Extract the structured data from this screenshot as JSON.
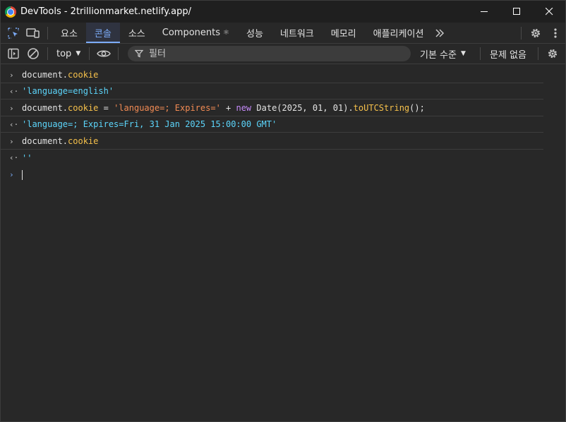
{
  "window": {
    "title": "DevTools - 2trillionmarket.netlify.app/",
    "controls": {
      "minimize": "─",
      "maximize": "☐",
      "close": "✕"
    }
  },
  "tabs": {
    "items": [
      {
        "label": "요소"
      },
      {
        "label": "콘솔"
      },
      {
        "label": "소스"
      },
      {
        "label": "Components",
        "badge": "⚛"
      },
      {
        "label": "성능"
      },
      {
        "label": "네트워크"
      },
      {
        "label": "메모리"
      },
      {
        "label": "애플리케이션"
      }
    ],
    "more": "»",
    "active_index": 1
  },
  "console_toolbar": {
    "context": "top",
    "filter_placeholder": "필터",
    "level": "기본 수준",
    "issues": "문제 없음"
  },
  "console": {
    "lines": [
      {
        "type": "input",
        "parts": [
          [
            "plain",
            "document."
          ],
          [
            "prop",
            "cookie"
          ]
        ]
      },
      {
        "type": "output",
        "text": "'language=english'"
      },
      {
        "type": "input",
        "parts": [
          [
            "plain",
            "document."
          ],
          [
            "prop",
            "cookie"
          ],
          [
            "plain",
            " = "
          ],
          [
            "str",
            "'language=; Expires='"
          ],
          [
            "plain",
            " + "
          ],
          [
            "key",
            "new"
          ],
          [
            "plain",
            " Date(2025, 01, 01)."
          ],
          [
            "fn",
            "toUTCString"
          ],
          [
            "plain",
            "();"
          ]
        ]
      },
      {
        "type": "output",
        "text": "'language=; Expires=Fri, 31 Jan 2025 15:00:00 GMT'"
      },
      {
        "type": "input",
        "parts": [
          [
            "plain",
            "document."
          ],
          [
            "prop",
            "cookie"
          ]
        ]
      },
      {
        "type": "output",
        "text": "''"
      }
    ]
  },
  "colors": {
    "accent": "#7cacf8",
    "background": "#282828",
    "string": "#f28b54",
    "property": "#f5c04b",
    "keyword": "#c58af9",
    "result": "#5cd5fb"
  }
}
